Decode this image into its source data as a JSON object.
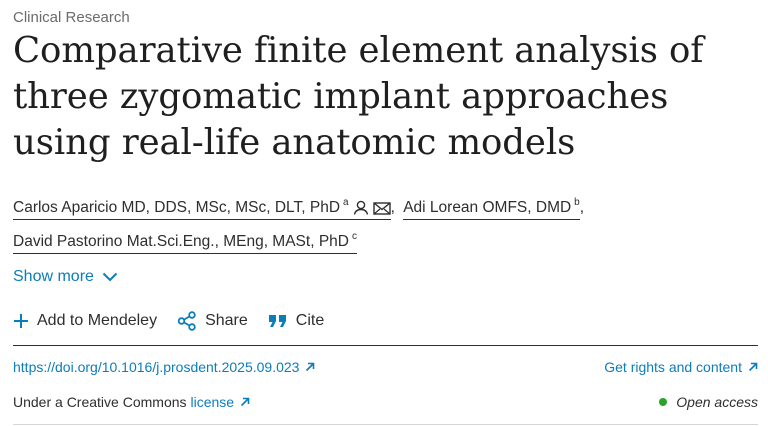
{
  "article": {
    "category": "Clinical Research",
    "title": "Comparative finite element analysis of three zygomatic implant approaches using real-life anatomic models"
  },
  "authors": [
    {
      "name": "Carlos Aparicio MD, DDS, MSc, MSc, DLT, PhD",
      "sup": "a",
      "separator": ","
    },
    {
      "name": "Adi Lorean OMFS, DMD",
      "sup": "b",
      "separator": ","
    },
    {
      "name": "David Pastorino Mat.Sci.Eng., MEng, MASt, PhD",
      "sup": "c",
      "separator": ""
    }
  ],
  "show_more": {
    "label": "Show more",
    "icon": "chevron-down-icon"
  },
  "actions": {
    "add_mendeley": "Add to Mendeley",
    "share": "Share",
    "cite": "Cite"
  },
  "links": {
    "doi": "https://doi.org/10.1016/j.prosdent.2025.09.023",
    "rights": "Get rights and content"
  },
  "license": {
    "prefix": "Under a Creative Commons",
    "link": "license",
    "open_access": "Open access"
  },
  "colors": {
    "link": "#0c7dbb",
    "text": "#2e2e2e",
    "open_access_dot": "#29a329"
  }
}
